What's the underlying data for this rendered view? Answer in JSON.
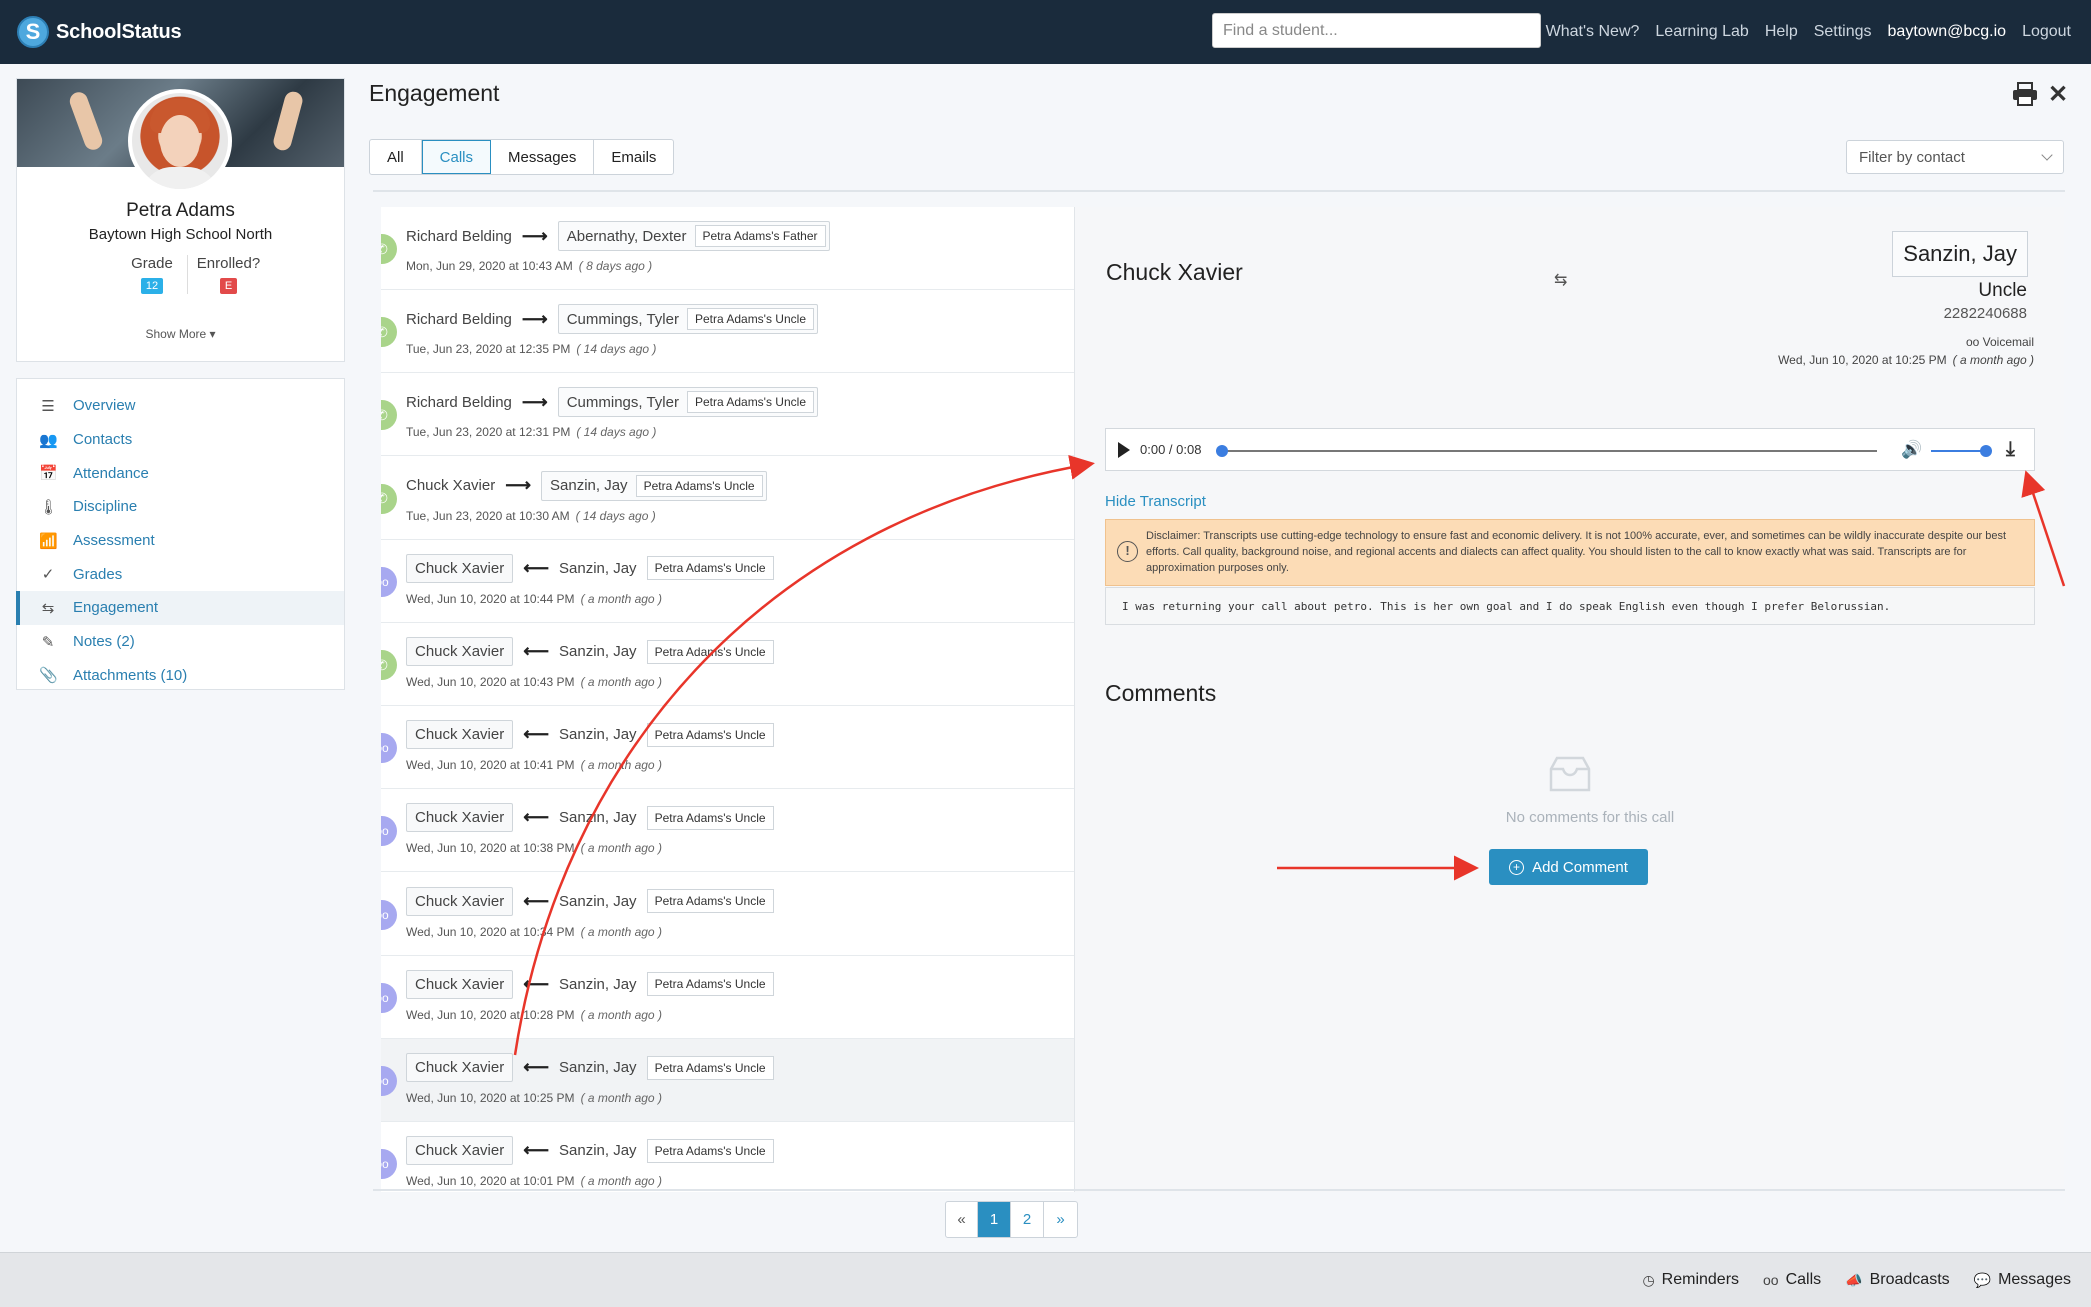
{
  "brand": {
    "name": "SchoolStatus",
    "logo_letter": "S"
  },
  "search": {
    "placeholder": "Find a student..."
  },
  "nav": {
    "links": [
      "What's New?",
      "Learning Lab",
      "Help",
      "Settings"
    ],
    "user": "baytown@bcg.io",
    "logout": "Logout"
  },
  "student": {
    "name": "Petra Adams",
    "school": "Baytown High School North",
    "grade_label": "Grade",
    "grade_value": "12",
    "enrolled_label": "Enrolled?",
    "enrolled_value": "E",
    "show_more": "Show More ▾"
  },
  "side_menu": [
    {
      "label": "Overview",
      "icon": "☰"
    },
    {
      "label": "Contacts",
      "icon": "👥"
    },
    {
      "label": "Attendance",
      "icon": "📅"
    },
    {
      "label": "Discipline",
      "icon": "🌡"
    },
    {
      "label": "Assessment",
      "icon": "📶"
    },
    {
      "label": "Grades",
      "icon": "✓"
    },
    {
      "label": "Engagement",
      "icon": "⇆"
    },
    {
      "label": "Notes (2)",
      "icon": "✎"
    },
    {
      "label": "Attachments (10)",
      "icon": "📎"
    }
  ],
  "page": {
    "title": "Engagement"
  },
  "tabs": [
    {
      "label": "All"
    },
    {
      "label": "Calls"
    },
    {
      "label": "Messages"
    },
    {
      "label": "Emails"
    }
  ],
  "filter": {
    "placeholder": "Filter by contact"
  },
  "calls": [
    {
      "type": "call",
      "direction": "out",
      "staff": "Richard Belding",
      "contact": "Abernathy, Dexter",
      "relation": "Petra Adams's Father",
      "date": "Mon, Jun 29, 2020 at 10:43 AM",
      "ago": "( 8 days ago )"
    },
    {
      "type": "call",
      "direction": "out",
      "staff": "Richard Belding",
      "contact": "Cummings, Tyler",
      "relation": "Petra Adams's Uncle",
      "date": "Tue, Jun 23, 2020 at 12:35 PM",
      "ago": "( 14 days ago )"
    },
    {
      "type": "call",
      "direction": "out",
      "staff": "Richard Belding",
      "contact": "Cummings, Tyler",
      "relation": "Petra Adams's Uncle",
      "date": "Tue, Jun 23, 2020 at 12:31 PM",
      "ago": "( 14 days ago )"
    },
    {
      "type": "call",
      "direction": "out",
      "staff": "Chuck Xavier",
      "contact": "Sanzin, Jay",
      "relation": "Petra Adams's Uncle",
      "date": "Tue, Jun 23, 2020 at 10:30 AM",
      "ago": "( 14 days ago )"
    },
    {
      "type": "vm",
      "direction": "in",
      "staff": "Chuck Xavier",
      "contact": "Sanzin, Jay",
      "relation": "Petra Adams's Uncle",
      "date": "Wed, Jun 10, 2020 at 10:44 PM",
      "ago": "( a month ago )"
    },
    {
      "type": "call",
      "direction": "in",
      "staff": "Chuck Xavier",
      "contact": "Sanzin, Jay",
      "relation": "Petra Adams's Uncle",
      "date": "Wed, Jun 10, 2020 at 10:43 PM",
      "ago": "( a month ago )"
    },
    {
      "type": "vm",
      "direction": "in",
      "staff": "Chuck Xavier",
      "contact": "Sanzin, Jay",
      "relation": "Petra Adams's Uncle",
      "date": "Wed, Jun 10, 2020 at 10:41 PM",
      "ago": "( a month ago )"
    },
    {
      "type": "vm",
      "direction": "in",
      "staff": "Chuck Xavier",
      "contact": "Sanzin, Jay",
      "relation": "Petra Adams's Uncle",
      "date": "Wed, Jun 10, 2020 at 10:38 PM",
      "ago": "( a month ago )"
    },
    {
      "type": "vm",
      "direction": "in",
      "staff": "Chuck Xavier",
      "contact": "Sanzin, Jay",
      "relation": "Petra Adams's Uncle",
      "date": "Wed, Jun 10, 2020 at 10:34 PM",
      "ago": "( a month ago )"
    },
    {
      "type": "vm",
      "direction": "in",
      "staff": "Chuck Xavier",
      "contact": "Sanzin, Jay",
      "relation": "Petra Adams's Uncle",
      "date": "Wed, Jun 10, 2020 at 10:28 PM",
      "ago": "( a month ago )"
    },
    {
      "type": "vm",
      "direction": "in",
      "staff": "Chuck Xavier",
      "contact": "Sanzin, Jay",
      "relation": "Petra Adams's Uncle",
      "date": "Wed, Jun 10, 2020 at 10:25 PM",
      "ago": "( a month ago )",
      "selected": true
    },
    {
      "type": "vm",
      "direction": "in",
      "staff": "Chuck Xavier",
      "contact": "Sanzin, Jay",
      "relation": "Petra Adams's Uncle",
      "date": "Wed, Jun 10, 2020 at 10:01 PM",
      "ago": "( a month ago )"
    }
  ],
  "detail": {
    "caller": "Chuck Xavier",
    "callee": "Sanzin, Jay",
    "relation": "Uncle",
    "phone": "2282240688",
    "type_label": "Voicemail",
    "date": "Wed, Jun 10, 2020 at 10:25 PM",
    "ago": "( a month ago )",
    "player_time": "0:00 / 0:08",
    "progress": 0,
    "volume": 1,
    "hide_transcript": "Hide Transcript",
    "disclaimer": "Disclaimer: Transcripts use cutting-edge technology to ensure fast and economic delivery. It is not 100% accurate, ever, and sometimes can be wildly inaccurate despite our best efforts. Call quality, background noise, and regional accents and dialects can affect quality. You should listen to the call to know exactly what was said. Transcripts are for approximation purposes only.",
    "transcript": "I was returning your call about petro. This is her own goal and I do speak English even though I prefer Belorussian.",
    "comments_title": "Comments",
    "no_comments": "No comments for this call",
    "add_comment": "Add Comment"
  },
  "pagination": {
    "prev": "«",
    "pages": [
      "1",
      "2"
    ],
    "current": "1",
    "next": "»"
  },
  "footer": [
    {
      "label": "Reminders",
      "icon": "◷"
    },
    {
      "label": "Calls",
      "icon": "oo"
    },
    {
      "label": "Broadcasts",
      "icon": "📣"
    },
    {
      "label": "Messages",
      "icon": "💬"
    }
  ],
  "colors": {
    "nav_bg": "#1a2b3c",
    "accent": "#2a8fc1",
    "annotation": "#e8352a",
    "call_icon": "#a9d48a",
    "voicemail_icon": "#a7a9f0"
  }
}
